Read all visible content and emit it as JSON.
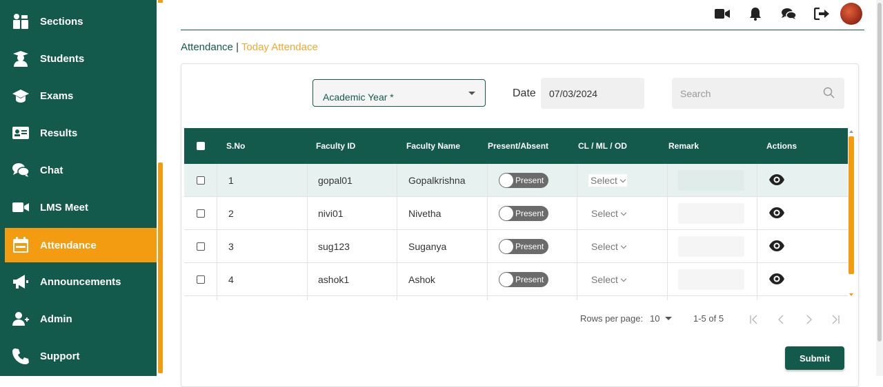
{
  "sidebar": {
    "items": [
      {
        "label": "Sections",
        "icon": "sections-icon"
      },
      {
        "label": "Students",
        "icon": "student-icon"
      },
      {
        "label": "Exams",
        "icon": "graduation-cap-icon"
      },
      {
        "label": "Results",
        "icon": "id-card-icon"
      },
      {
        "label": "Chat",
        "icon": "chat-icon"
      },
      {
        "label": "LMS Meet",
        "icon": "video-icon"
      },
      {
        "label": "Attendance",
        "icon": "calendar-icon",
        "active": true
      },
      {
        "label": "Announcements",
        "icon": "megaphone-icon"
      },
      {
        "label": "Admin",
        "icon": "add-user-icon"
      },
      {
        "label": "Support",
        "icon": "phone-icon"
      }
    ]
  },
  "breadcrumb": {
    "first": "Attendance",
    "separator": "|",
    "second": "Today Attendace"
  },
  "filters": {
    "academic_year_label": "Academic Year *",
    "date_label": "Date",
    "date_value": "07/03/2024",
    "search_placeholder": "Search"
  },
  "table": {
    "headers": [
      "S.No",
      "Faculty ID",
      "Faculty Name",
      "Present/Absent",
      "CL / ML / OD",
      "Remark",
      "Actions"
    ],
    "rows": [
      {
        "sno": "1",
        "faculty_id": "gopal01",
        "faculty_name": "Gopalkrishna",
        "status": "Present",
        "leave": "Select"
      },
      {
        "sno": "2",
        "faculty_id": "nivi01",
        "faculty_name": "Nivetha",
        "status": "Present",
        "leave": "Select"
      },
      {
        "sno": "3",
        "faculty_id": "sug123",
        "faculty_name": "Suganya",
        "status": "Present",
        "leave": "Select"
      },
      {
        "sno": "4",
        "faculty_id": "ashok1",
        "faculty_name": "Ashok",
        "status": "Present",
        "leave": "Select"
      }
    ]
  },
  "pagination": {
    "rows_per_page_label": "Rows per page:",
    "rows_per_page": "10",
    "range": "1-5 of 5"
  },
  "submit_label": "Submit",
  "colors": {
    "primary": "#135a4c",
    "accent": "#f39c12",
    "link": "#f0a830"
  }
}
